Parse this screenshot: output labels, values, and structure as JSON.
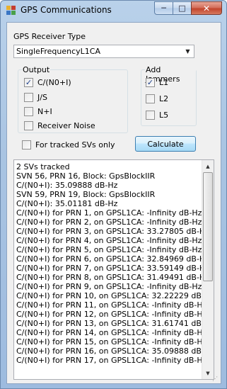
{
  "window": {
    "title": "GPS Communications",
    "caption_buttons": {
      "minimize": "─",
      "maximize": "□",
      "close": "✕"
    }
  },
  "receiver": {
    "label": "GPS Receiver Type",
    "selected": "SingleFrequencyL1CA"
  },
  "output_group": {
    "title": "Output",
    "items": [
      {
        "label": "C/(N0+I)",
        "checked": true
      },
      {
        "label": "J/S",
        "checked": false
      },
      {
        "label": "N+I",
        "checked": false
      },
      {
        "label": "Receiver Noise",
        "checked": false
      }
    ]
  },
  "jammers_group": {
    "title": "Add Jammers",
    "items": [
      {
        "label": "L1",
        "checked": true
      },
      {
        "label": "L2",
        "checked": false
      },
      {
        "label": "L5",
        "checked": false
      }
    ]
  },
  "tracked_only": {
    "label": "For tracked SVs only",
    "checked": false
  },
  "calculate_button": "Calculate",
  "results": [
    "2 SVs tracked",
    "SVN 56, PRN 16, Block: GpsBlockIIR",
    "C/(N0+I): 35.09888 dB-Hz",
    "SVN 59, PRN 19, Block: GpsBlockIIR",
    "C/(N0+I): 35.01181 dB-Hz",
    "C/(N0+I) for PRN 1, on GPSL1CA: -Infinity dB-Hz",
    "C/(N0+I) for PRN 2, on GPSL1CA: -Infinity dB-Hz",
    "C/(N0+I) for PRN 3, on GPSL1CA: 33.27805 dB-Hz",
    "C/(N0+I) for PRN 4, on GPSL1CA: -Infinity dB-Hz",
    "C/(N0+I) for PRN 5, on GPSL1CA: -Infinity dB-Hz",
    "C/(N0+I) for PRN 6, on GPSL1CA: 32.84969 dB-Hz",
    "C/(N0+I) for PRN 7, on GPSL1CA: 33.59149 dB-Hz",
    "C/(N0+I) for PRN 8, on GPSL1CA: 31.49491 dB-Hz",
    "C/(N0+I) for PRN 9, on GPSL1CA: -Infinity dB-Hz",
    "C/(N0+I) for PRN 10, on GPSL1CA: 32.22229 dB-Hz",
    "C/(N0+I) for PRN 11, on GPSL1CA: -Infinity dB-Hz",
    "C/(N0+I) for PRN 12, on GPSL1CA: -Infinity dB-Hz",
    "C/(N0+I) for PRN 13, on GPSL1CA: 31.61741 dB-Hz",
    "C/(N0+I) for PRN 14, on GPSL1CA: -Infinity dB-Hz",
    "C/(N0+I) for PRN 15, on GPSL1CA: -Infinity dB-Hz",
    "C/(N0+I) for PRN 16, on GPSL1CA: 35.09888 dB-Hz",
    "C/(N0+I) for PRN 17, on GPSL1CA: -Infinity dB-Hz"
  ],
  "colors": {
    "title_bar": "#b9d1ea",
    "button_accent": "#3c7fb1",
    "close_button": "#c2452d",
    "check_mark": "#1e3f8a"
  }
}
